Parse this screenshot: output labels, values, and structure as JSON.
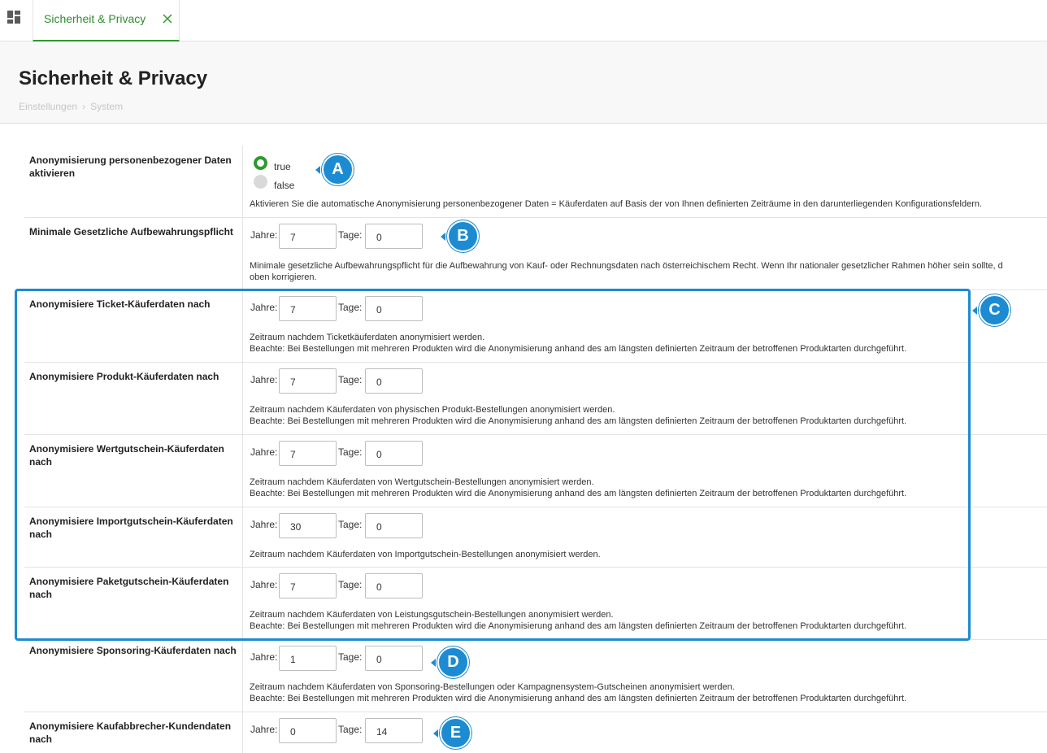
{
  "tab": {
    "label": "Sicherheit & Privacy"
  },
  "header": {
    "title": "Sicherheit & Privacy",
    "breadcrumb": [
      "Einstellungen",
      "System"
    ]
  },
  "anonymize": {
    "label": "Anonymisierung personenbezogener Daten aktivieren",
    "options": [
      "true",
      "false"
    ],
    "selected": "true",
    "description": "Aktivieren Sie die automatische Anonymisierung personenbezogener Daten = Käuferdaten auf Basis der von Ihnen definierten Zeiträume in den darunterliegenden Konfigurationsfeldern."
  },
  "fields": {
    "years_label": "Jahre:",
    "days_label": "Tage:"
  },
  "rows": [
    {
      "label": "Minimale Gesetzliche Aufbewahrungspflicht",
      "years": "7",
      "days": "0",
      "desc1": "Minimale gesetzliche Aufbewahrungspflicht für die Aufbewahrung von Kauf- oder Rechnungsdaten nach österreichischem Recht. Wenn Ihr nationaler gesetzlicher Rahmen höher sein sollte, d",
      "desc2": "oben korrigieren."
    },
    {
      "label": "Anonymisiere Ticket-Käuferdaten nach",
      "years": "7",
      "days": "0",
      "desc1": "Zeitraum nachdem Ticketkäuferdaten anonymisiert werden.",
      "desc2": "Beachte: Bei Bestellungen mit mehreren Produkten wird die Anonymisierung anhand des am längsten definierten Zeitraum der betroffenen Produktarten durchgeführt."
    },
    {
      "label": "Anonymisiere Produkt-Käuferdaten nach",
      "years": "7",
      "days": "0",
      "desc1": "Zeitraum nachdem Käuferdaten von physischen Produkt-Bestellungen anonymisiert werden.",
      "desc2": "Beachte: Bei Bestellungen mit mehreren Produkten wird die Anonymisierung anhand des am längsten definierten Zeitraum der betroffenen Produktarten durchgeführt."
    },
    {
      "label": "Anonymisiere Wertgutschein-Käuferdaten nach",
      "years": "7",
      "days": "0",
      "desc1": "Zeitraum nachdem Käuferdaten von Wertgutschein-Bestellungen anonymisiert werden.",
      "desc2": "Beachte: Bei Bestellungen mit mehreren Produkten wird die Anonymisierung anhand des am längsten definierten Zeitraum der betroffenen Produktarten durchgeführt."
    },
    {
      "label": "Anonymisiere Importgutschein-Käuferdaten nach",
      "years": "30",
      "days": "0",
      "desc1": "Zeitraum nachdem Käuferdaten von Importgutschein-Bestellungen anonymisiert werden.",
      "desc2": ""
    },
    {
      "label": "Anonymisiere Paketgutschein-Käuferdaten nach",
      "years": "7",
      "days": "0",
      "desc1": "Zeitraum nachdem Käuferdaten von Leistungsgutschein-Bestellungen anonymisiert werden.",
      "desc2": "Beachte: Bei Bestellungen mit mehreren Produkten wird die Anonymisierung anhand des am längsten definierten Zeitraum der betroffenen Produktarten durchgeführt."
    },
    {
      "label": "Anonymisiere Sponsoring-Käuferdaten nach",
      "years": "1",
      "days": "0",
      "desc1": "Zeitraum nachdem Käuferdaten von Sponsoring-Bestellungen oder Kampagnensystem-Gutscheinen anonymisiert werden.",
      "desc2": "Beachte: Bei Bestellungen mit mehreren Produkten wird die Anonymisierung anhand des am längsten definierten Zeitraum der betroffenen Produktarten durchgeführt."
    },
    {
      "label": "Anonymisiere Kaufabbrecher-Kundendaten nach",
      "years": "0",
      "days": "14",
      "desc1": "",
      "desc2": ""
    }
  ],
  "callouts": [
    "A",
    "B",
    "C",
    "D",
    "E"
  ],
  "colors": {
    "accent_green": "#2e9a2e",
    "callout_blue": "#1d8bd1"
  }
}
